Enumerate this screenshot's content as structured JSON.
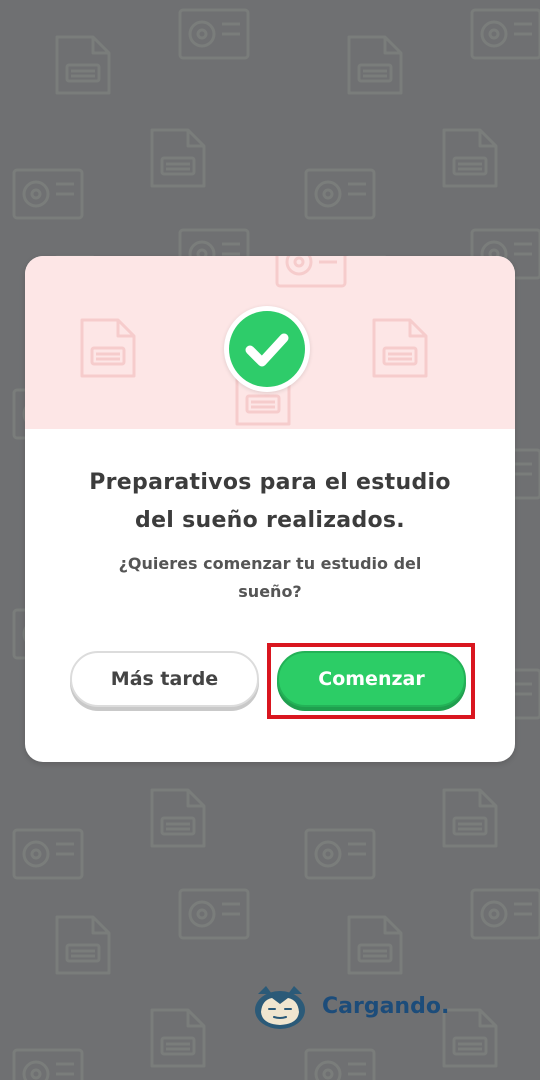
{
  "dialog": {
    "title_line1": "Preparativos para el estudio",
    "title_line2": "del sueño realizados.",
    "message_line1": "¿Quieres comenzar tu estudio del",
    "message_line2": "sueño?",
    "later_label": "Más tarde",
    "start_label": "Comenzar",
    "status_icon": "check-circle-icon"
  },
  "loading": {
    "text": "Cargando.",
    "icon": "snorlax-icon"
  },
  "colors": {
    "backdrop": "#6f7072",
    "header_tint": "#fde6e6",
    "success_green": "#2ecc6a",
    "highlight_red": "#d9161f",
    "loading_text": "#1c4c7a"
  }
}
